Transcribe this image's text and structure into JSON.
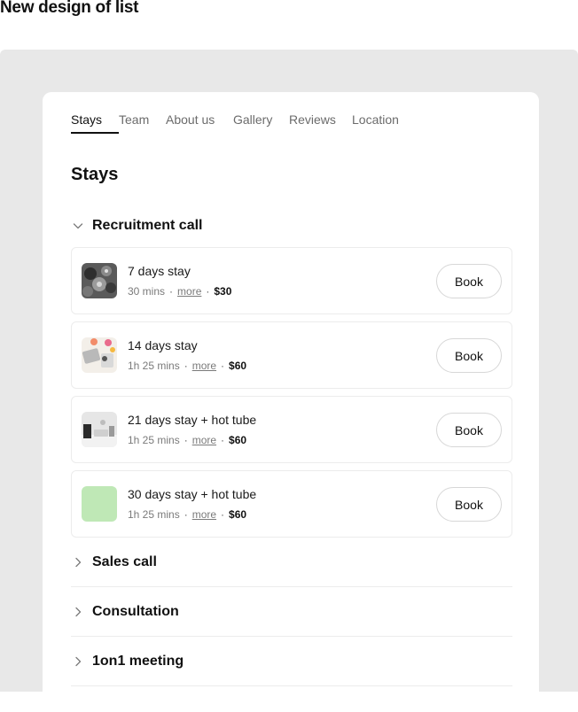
{
  "page_heading": "New design of list",
  "tabs": [
    {
      "label": "Stays",
      "active": true
    },
    {
      "label": "Team",
      "active": false
    },
    {
      "label": "About us",
      "active": false
    },
    {
      "label": "Gallery",
      "active": false
    },
    {
      "label": "Reviews",
      "active": false
    },
    {
      "label": "Location",
      "active": false
    }
  ],
  "section_title": "Stays",
  "open_group": {
    "label": "Recruitment call",
    "icon": "chevron-down-icon",
    "items": [
      {
        "name": "7 days stay",
        "duration": "30 mins",
        "more": "more",
        "price": "$30",
        "book": "Book",
        "thumb": "photo-thumbnail"
      },
      {
        "name": "14 days stay",
        "duration": "1h 25 mins",
        "more": "more",
        "price": "$60",
        "book": "Book",
        "thumb": "photo-thumbnail"
      },
      {
        "name": "21 days stay + hot tube",
        "duration": "1h 25 mins",
        "more": "more",
        "price": "$60",
        "book": "Book",
        "thumb": "photo-thumbnail"
      },
      {
        "name": "30 days stay + hot tube",
        "duration": "1h 25 mins",
        "more": "more",
        "price": "$60",
        "book": "Book",
        "thumb": "color-placeholder",
        "thumb_color": "#bfe8b6"
      }
    ]
  },
  "collapsed_groups": [
    {
      "label": "Sales call",
      "icon": "chevron-right-icon"
    },
    {
      "label": "Consultation",
      "icon": "chevron-right-icon"
    },
    {
      "label": "1on1 meeting",
      "icon": "chevron-right-icon"
    }
  ],
  "colors": {
    "backdrop": "#e8e8e8",
    "card": "#ffffff",
    "border": "#ececec",
    "text": "#111111",
    "muted": "#7a7a7a",
    "accent_thumb": "#bfe8b6"
  }
}
